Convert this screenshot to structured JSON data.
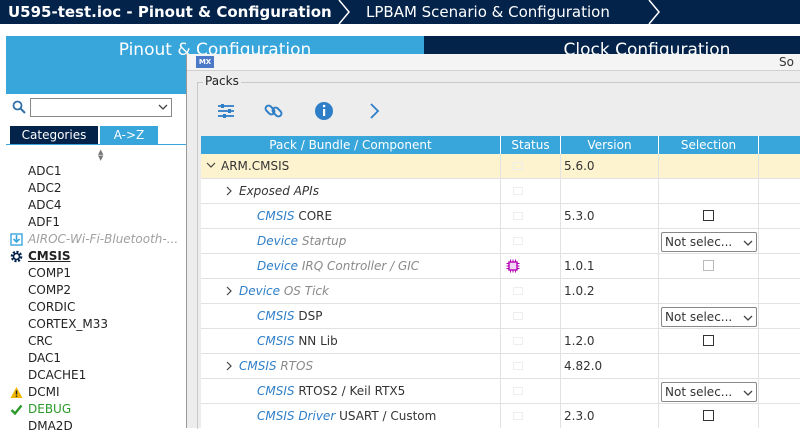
{
  "topbar": {
    "crumbs": [
      "U595-test.ioc - Pinout & Configuration",
      "LPBAM Scenario & Configuration"
    ]
  },
  "main_tabs": {
    "pinout": "Pinout & Configuration",
    "clock": "Clock Configuration"
  },
  "left_panel": {
    "search_value": "",
    "category_tab": "Categories",
    "az_tab": "A->Z",
    "peripherals": [
      {
        "label": "ADC1",
        "style": "normal",
        "icon": ""
      },
      {
        "label": "ADC2",
        "style": "normal",
        "icon": ""
      },
      {
        "label": "ADC4",
        "style": "normal",
        "icon": ""
      },
      {
        "label": "ADF1",
        "style": "normal",
        "icon": ""
      },
      {
        "label": "AIROC-Wi-Fi-Bluetooth-...",
        "style": "dim",
        "icon": "download-icon"
      },
      {
        "label": "CMSIS",
        "style": "bold",
        "icon": "gear-icon"
      },
      {
        "label": "COMP1",
        "style": "normal",
        "icon": ""
      },
      {
        "label": "COMP2",
        "style": "normal",
        "icon": ""
      },
      {
        "label": "CORDIC",
        "style": "normal",
        "icon": ""
      },
      {
        "label": "CORTEX_M33",
        "style": "normal",
        "icon": ""
      },
      {
        "label": "CRC",
        "style": "normal",
        "icon": ""
      },
      {
        "label": "DAC1",
        "style": "normal",
        "icon": ""
      },
      {
        "label": "DCACHE1",
        "style": "normal",
        "icon": ""
      },
      {
        "label": "DCMI",
        "style": "normal",
        "icon": "warning-icon"
      },
      {
        "label": "DEBUG",
        "style": "green",
        "icon": "check-icon"
      },
      {
        "label": "DMA2D",
        "style": "normal",
        "icon": ""
      }
    ]
  },
  "dialog": {
    "title": "Software Packs Component Selector",
    "title_visible": "So",
    "group_label": "Packs",
    "toolbar": [
      "settings-icon",
      "link-icon",
      "info-icon",
      "chevron-right-icon"
    ],
    "columns": [
      "Pack / Bundle / Component",
      "Status",
      "Version",
      "Selection"
    ],
    "rows": [
      {
        "indent": 0,
        "expander": "down",
        "parts": [
          {
            "t": "ARM.CMSIS",
            "c": "dark"
          }
        ],
        "status": "",
        "version": "5.6.0",
        "selection": "none",
        "highlight": true
      },
      {
        "indent": 1,
        "expander": "right",
        "parts": [
          {
            "t": "Exposed APIs",
            "c": "darkit"
          }
        ],
        "status": "",
        "version": "",
        "selection": "none",
        "highlight": false
      },
      {
        "indent": 2,
        "expander": "",
        "parts": [
          {
            "t": "CMSIS",
            "c": "blue"
          },
          {
            "t": " CORE",
            "c": "dark"
          }
        ],
        "status": "",
        "version": "5.3.0",
        "selection": "checkbox",
        "highlight": false
      },
      {
        "indent": 2,
        "expander": "",
        "parts": [
          {
            "t": "Device",
            "c": "blue"
          },
          {
            "t": " Startup",
            "c": "gray"
          }
        ],
        "status": "",
        "version": "",
        "selection": "dropdown",
        "highlight": false
      },
      {
        "indent": 2,
        "expander": "",
        "parts": [
          {
            "t": "Device",
            "c": "blue"
          },
          {
            "t": " IRQ Controller / GIC",
            "c": "gray"
          }
        ],
        "status": "chip",
        "version": "1.0.1",
        "selection": "checkbox-disabled",
        "highlight": false
      },
      {
        "indent": 1,
        "expander": "right",
        "parts": [
          {
            "t": "Device",
            "c": "blue"
          },
          {
            "t": " OS Tick",
            "c": "gray"
          }
        ],
        "status": "",
        "version": "1.0.2",
        "selection": "none",
        "highlight": false
      },
      {
        "indent": 2,
        "expander": "",
        "parts": [
          {
            "t": "CMSIS",
            "c": "blue"
          },
          {
            "t": " DSP",
            "c": "dark"
          }
        ],
        "status": "",
        "version": "",
        "selection": "dropdown",
        "highlight": false
      },
      {
        "indent": 2,
        "expander": "",
        "parts": [
          {
            "t": "CMSIS",
            "c": "blue"
          },
          {
            "t": " NN Lib",
            "c": "dark"
          }
        ],
        "status": "",
        "version": "1.2.0",
        "selection": "checkbox",
        "highlight": false
      },
      {
        "indent": 1,
        "expander": "right",
        "parts": [
          {
            "t": "CMSIS",
            "c": "blue"
          },
          {
            "t": " RTOS",
            "c": "gray"
          }
        ],
        "status": "",
        "version": "4.82.0",
        "selection": "none",
        "highlight": false
      },
      {
        "indent": 2,
        "expander": "",
        "parts": [
          {
            "t": "CMSIS",
            "c": "blue"
          },
          {
            "t": " RTOS2 / Keil RTX5",
            "c": "dark"
          }
        ],
        "status": "",
        "version": "",
        "selection": "dropdown",
        "highlight": false
      },
      {
        "indent": 2,
        "expander": "",
        "parts": [
          {
            "t": "CMSIS Driver",
            "c": "blue"
          },
          {
            "t": " USART / Custom",
            "c": "dark"
          }
        ],
        "status": "",
        "version": "2.3.0",
        "selection": "checkbox",
        "highlight": false
      }
    ],
    "dropdown_text": "Not selec..."
  },
  "colors": {
    "brand_dark": "#03234b",
    "brand_light": "#39a6db",
    "highlight_row": "#fdf3cf",
    "component_blue": "#2f7fc8"
  }
}
